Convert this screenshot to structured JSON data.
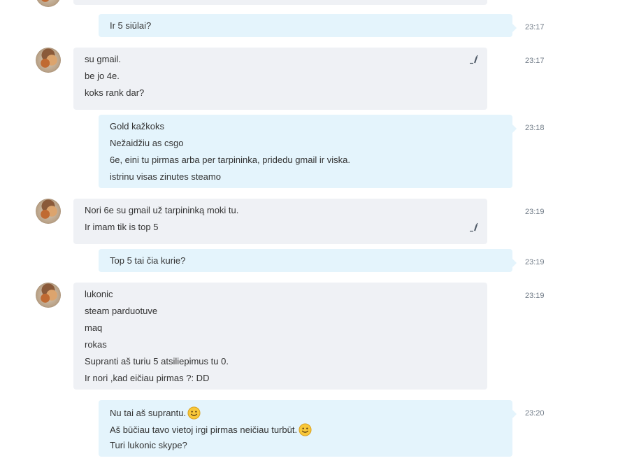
{
  "messages": [
    {
      "direction": "out",
      "time": "23:17",
      "lines": [
        "Ir 5 siūlai?"
      ]
    },
    {
      "direction": "in",
      "time": "23:17",
      "lines": [
        "su gmail.",
        "be jo 4e.",
        "koks rank dar?"
      ],
      "edited": true
    },
    {
      "direction": "out",
      "time": "23:18",
      "lines": [
        "Gold kažkoks",
        "Nežaidžiu as csgo",
        "6e, eini tu pirmas arba per tarpininka, pridedu gmail ir viska.",
        "istrinu visas zinutes steamo"
      ]
    },
    {
      "direction": "in",
      "time": "23:19",
      "lines": [
        "Nori 6e su gmail už tarpininką moki tu.",
        "Ir imam tik is top 5"
      ],
      "edited": true
    },
    {
      "direction": "out",
      "time": "23:19",
      "lines": [
        "Top 5 tai čia kurie?"
      ]
    },
    {
      "direction": "in",
      "time": "23:19",
      "lines": [
        "lukonic",
        "steam parduotuve",
        "maq",
        "rokas",
        "Supranti aš turiu 5 atsiliepimus tu 0.",
        "Ir nori ,kad eičiau pirmas ?: DD"
      ]
    },
    {
      "direction": "out",
      "time": "23:20",
      "lines": [
        "Nu tai aš suprantu.",
        "Aš būčiau tavo vietoj irgi pirmas neičiau turbūt.",
        "Turi lukonic skype?"
      ],
      "emoji_lines": [
        0,
        1
      ]
    }
  ],
  "icons": {
    "avatar": "contact-avatar",
    "edit": "pencil-edit-icon",
    "emoji": "smiley-emoticon"
  },
  "colors": {
    "incoming_bubble": "#eff1f5",
    "outgoing_bubble": "#e4f4fc",
    "timestamp": "#6f7a86"
  }
}
